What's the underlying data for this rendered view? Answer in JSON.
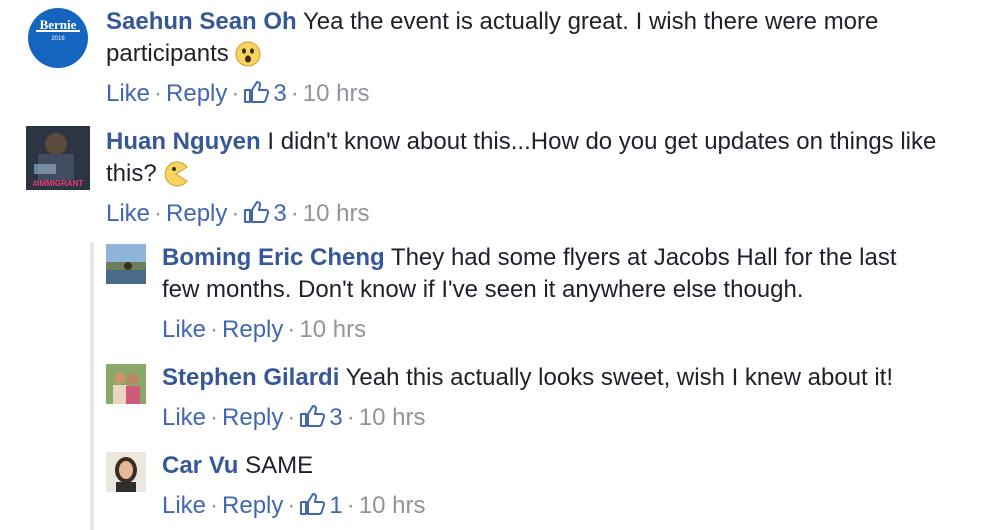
{
  "comments": [
    {
      "author": "Saehun Sean Oh",
      "text_line1": "Yea the event is actually great. I wish there were more",
      "text_line2": "participants",
      "emoji": "surprised-emoji",
      "avatar_text": "Bernie",
      "avatar_subtext": "2016",
      "like": "Like",
      "reply": "Reply",
      "reactions": "3",
      "time": "10 hrs"
    },
    {
      "author": "Huan Nguyen",
      "text_line1": "I didn't know about this...How do you get updates on things like",
      "text_line2": "this?",
      "emoji": "pacman-emoji",
      "avatar_text": "#IMMIGRANT",
      "like": "Like",
      "reply": "Reply",
      "reactions": "3",
      "time": "10 hrs"
    }
  ],
  "replies": [
    {
      "author": "Boming Eric Cheng",
      "text_line1": "They had some flyers at Jacobs Hall for the last",
      "text_line2": "few months. Don't know if I've seen it anywhere else though.",
      "like": "Like",
      "reply": "Reply",
      "time": "10 hrs"
    },
    {
      "author": "Stephen Gilardi",
      "text_line1": "Yeah this actually looks sweet, wish I knew about it!",
      "like": "Like",
      "reply": "Reply",
      "reactions": "3",
      "time": "10 hrs"
    },
    {
      "author": "Car Vu",
      "text_line1": "SAME",
      "like": "Like",
      "reply": "Reply",
      "reactions": "1",
      "time": "10 hrs"
    }
  ],
  "colors": {
    "author": "#365899",
    "link": "#4267b2",
    "meta": "#90949c",
    "thread_line": "#e5e6e9"
  }
}
